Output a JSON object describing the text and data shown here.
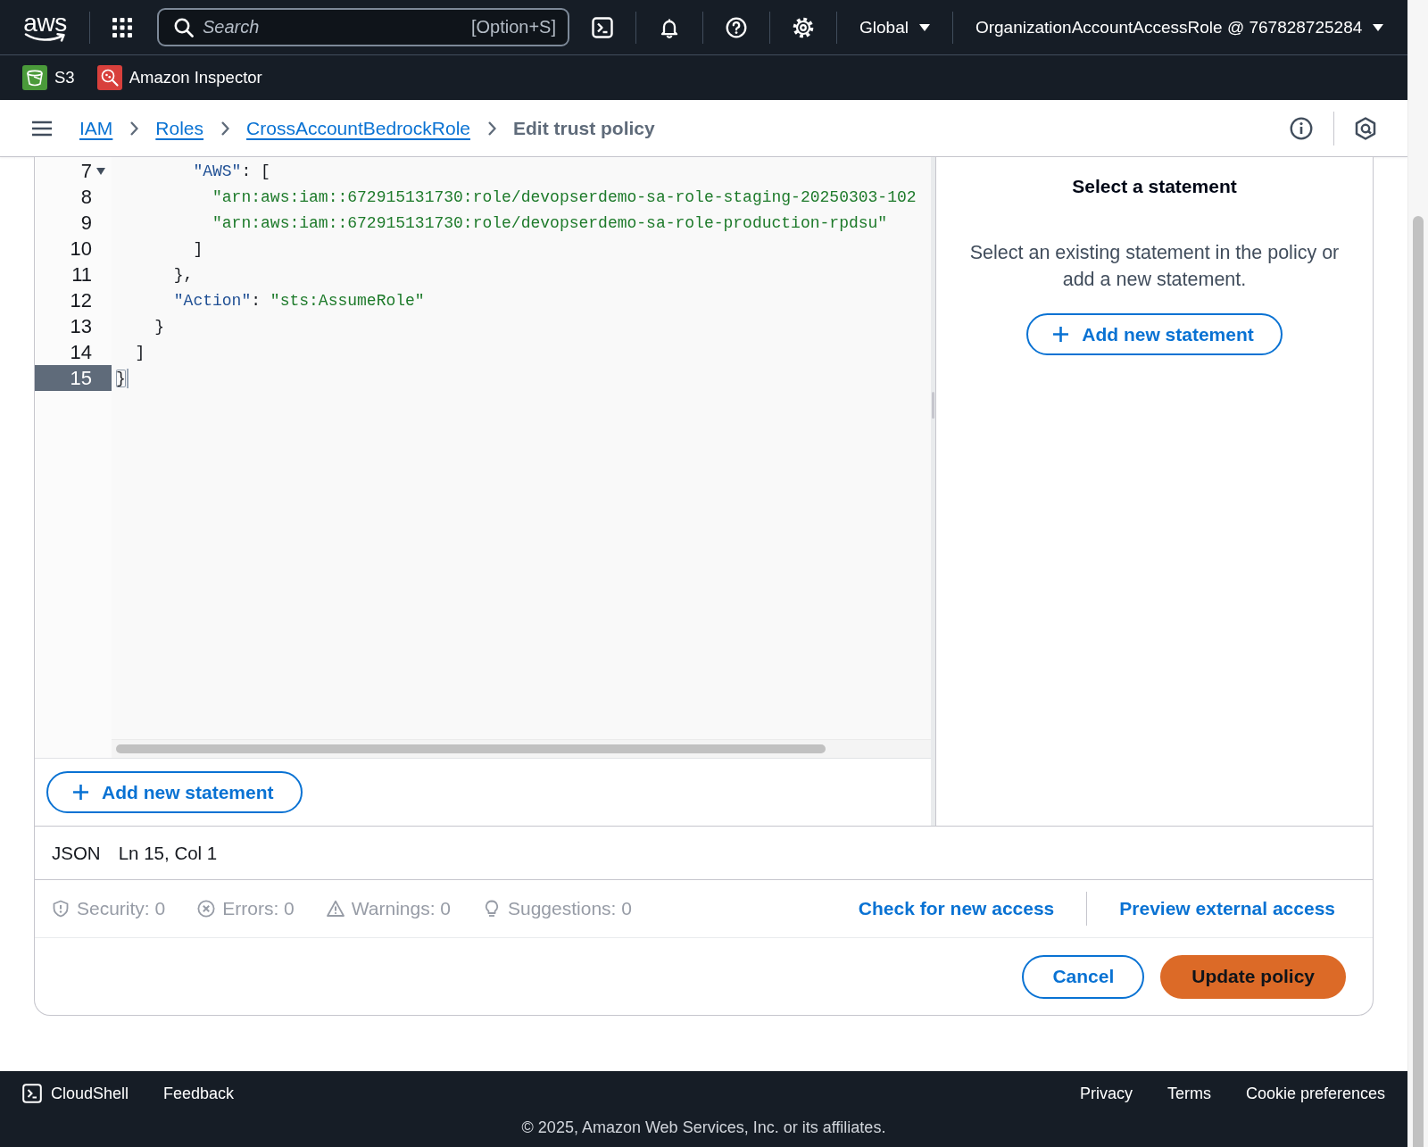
{
  "top_nav": {
    "logo": "aws",
    "search": {
      "placeholder": "Search",
      "shortcut": "[Option+S]"
    },
    "region": "Global",
    "account": "OrganizationAccountAccessRole @ 767828725284"
  },
  "favorites": [
    {
      "label": "S3",
      "kind": "storage",
      "color": "#4a9a3a"
    },
    {
      "label": "Amazon Inspector",
      "kind": "inspection",
      "color": "#d8403c"
    }
  ],
  "breadcrumbs": [
    {
      "label": "IAM",
      "kind": "link"
    },
    {
      "label": "Roles",
      "kind": "link"
    },
    {
      "label": "CrossAccountBedrockRole",
      "kind": "link"
    },
    {
      "label": "Edit trust policy",
      "kind": "current"
    }
  ],
  "editor": {
    "lines": [
      {
        "number": "7",
        "foldable": true,
        "active": false,
        "tokens": [
          {
            "text": "        \"AWS\"",
            "kind": "key"
          },
          {
            "text": ": [",
            "kind": "punct"
          }
        ]
      },
      {
        "number": "8",
        "foldable": false,
        "active": false,
        "tokens": [
          {
            "text": "          \"arn:aws:iam::672915131730:role/devopserdemo-sa-role-staging-20250303-102",
            "kind": "string"
          }
        ]
      },
      {
        "number": "9",
        "foldable": false,
        "active": false,
        "tokens": [
          {
            "text": "          \"arn:aws:iam::672915131730:role/devopserdemo-sa-role-production-rpdsu\"",
            "kind": "string"
          }
        ]
      },
      {
        "number": "10",
        "foldable": false,
        "active": false,
        "tokens": [
          {
            "text": "        ]",
            "kind": "punct"
          }
        ]
      },
      {
        "number": "11",
        "foldable": false,
        "active": false,
        "tokens": [
          {
            "text": "      },",
            "kind": "punct"
          }
        ]
      },
      {
        "number": "12",
        "foldable": false,
        "active": false,
        "tokens": [
          {
            "text": "      \"Action\"",
            "kind": "key"
          },
          {
            "text": ": ",
            "kind": "punct"
          },
          {
            "text": "\"sts:AssumeRole\"",
            "kind": "string"
          }
        ]
      },
      {
        "number": "13",
        "foldable": false,
        "active": false,
        "tokens": [
          {
            "text": "    }",
            "kind": "punct"
          }
        ]
      },
      {
        "number": "14",
        "foldable": false,
        "active": false,
        "tokens": [
          {
            "text": "  ]",
            "kind": "punct"
          }
        ]
      },
      {
        "number": "15",
        "foldable": false,
        "active": true,
        "tokens": [
          {
            "text": "}",
            "kind": "matched"
          }
        ]
      }
    ],
    "add_button": "Add new statement"
  },
  "statement_panel": {
    "title": "Select a statement",
    "text": "Select an existing statement in the policy or add a new statement.",
    "button": "Add new statement"
  },
  "status_bar": {
    "language": "JSON",
    "position": "Ln 15, Col 1"
  },
  "checks": {
    "items": [
      {
        "kind": "security",
        "label": "Security: 0"
      },
      {
        "kind": "errors",
        "label": "Errors: 0"
      },
      {
        "kind": "warnings",
        "label": "Warnings: 0"
      },
      {
        "kind": "suggestions",
        "label": "Suggestions: 0"
      }
    ],
    "links": [
      "Check for new access",
      "Preview external access"
    ]
  },
  "actions": [
    {
      "label": "Cancel",
      "kind": "secondary"
    },
    {
      "label": "Update policy",
      "kind": "primary"
    }
  ],
  "footer": {
    "left": [
      {
        "label": "CloudShell",
        "kind": "shell"
      },
      {
        "label": "Feedback",
        "kind": "text"
      }
    ],
    "right": [
      "Privacy",
      "Terms",
      "Cookie preferences"
    ],
    "copyright": "© 2025, Amazon Web Services, Inc. or its affiliates."
  }
}
